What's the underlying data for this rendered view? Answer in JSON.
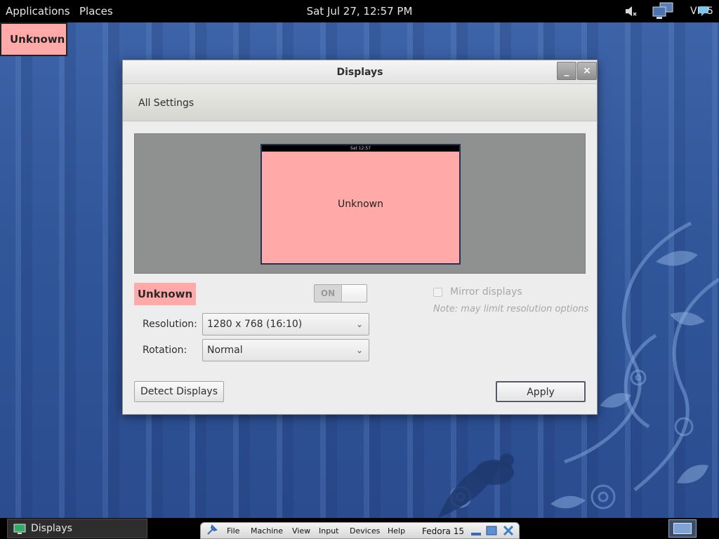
{
  "top_panel": {
    "applications_label": "Applications",
    "places_label": "Places",
    "clock": "Sat Jul 27, 12:57 PM",
    "tray_label": "VI",
    "tray_label_suffix": "5",
    "icons": [
      "volume-muted-icon",
      "network-icon",
      "chat-icon"
    ]
  },
  "desktop": {
    "output_label": "Unknown"
  },
  "dialog": {
    "title": "Displays",
    "toolbar": {
      "all_settings": "All Settings"
    },
    "monitor_preview": {
      "top_bar_clock": "Sat 12:57",
      "label": "Unknown"
    },
    "output": {
      "name": "Unknown",
      "switch_state": "ON",
      "mirror_label": "Mirror displays",
      "mirror_checked": false,
      "mirror_note": "Note: may limit resolution options"
    },
    "resolution": {
      "label": "Resolution:",
      "value": "1280 x 768 (16:10)"
    },
    "rotation": {
      "label": "Rotation:",
      "value": "Normal"
    },
    "buttons": {
      "detect": "Detect Displays",
      "apply": "Apply"
    }
  },
  "bottom_panel": {
    "task_label": "Displays",
    "vbox": {
      "menus": [
        "File",
        "Machine",
        "View",
        "Input",
        "Devices",
        "Help"
      ],
      "vm_name": "Fedora 15"
    }
  },
  "colors": {
    "unknown_output": "#ffaaa8",
    "panel": "#000000",
    "wallpaper": "#31569a"
  }
}
